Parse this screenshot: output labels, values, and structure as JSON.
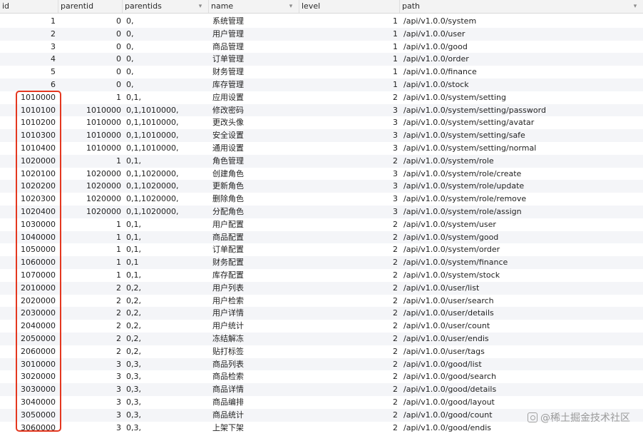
{
  "columns": [
    {
      "key": "id",
      "label": "id",
      "sortable": false
    },
    {
      "key": "parentid",
      "label": "parentid",
      "sortable": false
    },
    {
      "key": "parentids",
      "label": "parentids",
      "sortable": true
    },
    {
      "key": "name",
      "label": "name",
      "sortable": true
    },
    {
      "key": "level",
      "label": "level",
      "sortable": false
    },
    {
      "key": "path",
      "label": "path",
      "sortable": true
    }
  ],
  "rows": [
    {
      "id": "1",
      "parentid": "0",
      "parentids": "0,",
      "name": "系统管理",
      "level": "1",
      "path": "/api/v1.0.0/system"
    },
    {
      "id": "2",
      "parentid": "0",
      "parentids": "0,",
      "name": "用户管理",
      "level": "1",
      "path": "/api/v1.0.0/user"
    },
    {
      "id": "3",
      "parentid": "0",
      "parentids": "0,",
      "name": "商品管理",
      "level": "1",
      "path": "/api/v1.0.0/good"
    },
    {
      "id": "4",
      "parentid": "0",
      "parentids": "0,",
      "name": "订单管理",
      "level": "1",
      "path": "/api/v1.0.0/order"
    },
    {
      "id": "5",
      "parentid": "0",
      "parentids": "0,",
      "name": "财务管理",
      "level": "1",
      "path": "/api/v1.0.0/finance"
    },
    {
      "id": "6",
      "parentid": "0",
      "parentids": "0,",
      "name": "库存管理",
      "level": "1",
      "path": "/api/v1.0.0/stock"
    },
    {
      "id": "1010000",
      "parentid": "1",
      "parentids": "0,1,",
      "name": "应用设置",
      "level": "2",
      "path": "/api/v1.0.0/system/setting"
    },
    {
      "id": "1010100",
      "parentid": "1010000",
      "parentids": "0,1,1010000,",
      "name": "修改密码",
      "level": "3",
      "path": "/api/v1.0.0/system/setting/password"
    },
    {
      "id": "1010200",
      "parentid": "1010000",
      "parentids": "0,1,1010000,",
      "name": "更改头像",
      "level": "3",
      "path": "/api/v1.0.0/system/setting/avatar"
    },
    {
      "id": "1010300",
      "parentid": "1010000",
      "parentids": "0,1,1010000,",
      "name": "安全设置",
      "level": "3",
      "path": "/api/v1.0.0/system/setting/safe"
    },
    {
      "id": "1010400",
      "parentid": "1010000",
      "parentids": "0,1,1010000,",
      "name": "通用设置",
      "level": "3",
      "path": "/api/v1.0.0/system/setting/normal"
    },
    {
      "id": "1020000",
      "parentid": "1",
      "parentids": "0,1,",
      "name": "角色管理",
      "level": "2",
      "path": "/api/v1.0.0/system/role"
    },
    {
      "id": "1020100",
      "parentid": "1020000",
      "parentids": "0,1,1020000,",
      "name": "创建角色",
      "level": "3",
      "path": "/api/v1.0.0/system/role/create"
    },
    {
      "id": "1020200",
      "parentid": "1020000",
      "parentids": "0,1,1020000,",
      "name": "更新角色",
      "level": "3",
      "path": "/api/v1.0.0/system/role/update"
    },
    {
      "id": "1020300",
      "parentid": "1020000",
      "parentids": "0,1,1020000,",
      "name": "删除角色",
      "level": "3",
      "path": "/api/v1.0.0/system/role/remove"
    },
    {
      "id": "1020400",
      "parentid": "1020000",
      "parentids": "0,1,1020000,",
      "name": "分配角色",
      "level": "3",
      "path": "/api/v1.0.0/system/role/assign"
    },
    {
      "id": "1030000",
      "parentid": "1",
      "parentids": "0,1,",
      "name": "用户配置",
      "level": "2",
      "path": "/api/v1.0.0/system/user"
    },
    {
      "id": "1040000",
      "parentid": "1",
      "parentids": "0,1,",
      "name": "商品配置",
      "level": "2",
      "path": "/api/v1.0.0/system/good"
    },
    {
      "id": "1050000",
      "parentid": "1",
      "parentids": "0,1,",
      "name": "订单配置",
      "level": "2",
      "path": "/api/v1.0.0/system/order"
    },
    {
      "id": "1060000",
      "parentid": "1",
      "parentids": "0,1",
      "name": "财务配置",
      "level": "2",
      "path": "/api/v1.0.0/system/finance"
    },
    {
      "id": "1070000",
      "parentid": "1",
      "parentids": "0,1,",
      "name": "库存配置",
      "level": "2",
      "path": "/api/v1.0.0/system/stock"
    },
    {
      "id": "2010000",
      "parentid": "2",
      "parentids": "0,2,",
      "name": "用户列表",
      "level": "2",
      "path": "/api/v1.0.0/user/list"
    },
    {
      "id": "2020000",
      "parentid": "2",
      "parentids": "0,2,",
      "name": "用户检索",
      "level": "2",
      "path": "/api/v1.0.0/user/search"
    },
    {
      "id": "2030000",
      "parentid": "2",
      "parentids": "0,2,",
      "name": "用户详情",
      "level": "2",
      "path": "/api/v1.0.0/user/details"
    },
    {
      "id": "2040000",
      "parentid": "2",
      "parentids": "0,2,",
      "name": "用户统计",
      "level": "2",
      "path": "/api/v1.0.0/user/count"
    },
    {
      "id": "2050000",
      "parentid": "2",
      "parentids": "0,2,",
      "name": "冻结解冻",
      "level": "2",
      "path": "/api/v1.0.0/user/endis"
    },
    {
      "id": "2060000",
      "parentid": "2",
      "parentids": "0,2,",
      "name": "贴打标签",
      "level": "2",
      "path": "/api/v1.0.0/user/tags"
    },
    {
      "id": "3010000",
      "parentid": "3",
      "parentids": "0,3,",
      "name": "商品列表",
      "level": "2",
      "path": "/api/v1.0.0/good/list"
    },
    {
      "id": "3020000",
      "parentid": "3",
      "parentids": "0,3,",
      "name": "商品检索",
      "level": "2",
      "path": "/api/v1.0.0/good/search"
    },
    {
      "id": "3030000",
      "parentid": "3",
      "parentids": "0,3,",
      "name": "商品详情",
      "level": "2",
      "path": "/api/v1.0.0/good/details"
    },
    {
      "id": "3040000",
      "parentid": "3",
      "parentids": "0,3,",
      "name": "商品编排",
      "level": "2",
      "path": "/api/v1.0.0/good/layout"
    },
    {
      "id": "3050000",
      "parentid": "3",
      "parentids": "0,3,",
      "name": "商品统计",
      "level": "2",
      "path": "/api/v1.0.0/good/count"
    },
    {
      "id": "3060000",
      "parentid": "3",
      "parentids": "0,3,",
      "name": "上架下架",
      "level": "2",
      "path": "/api/v1.0.0/good/endis"
    }
  ],
  "sort_icon": "chevron-down-icon",
  "highlight_color": "#e4371f",
  "watermark": {
    "text": "@稀土掘金技术社区",
    "icon": "juejin-logo-icon"
  }
}
